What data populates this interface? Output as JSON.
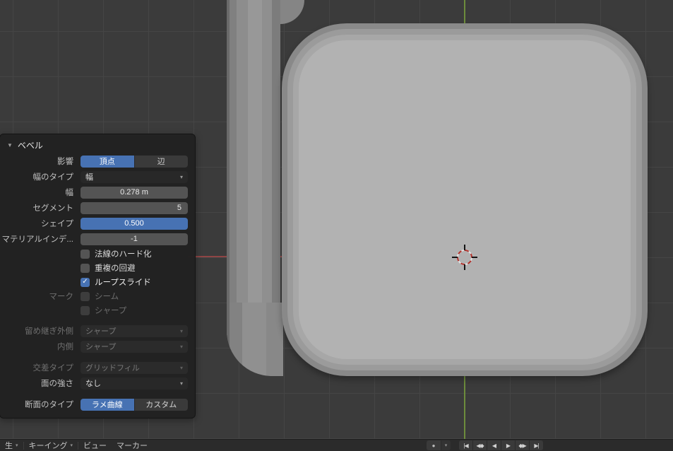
{
  "icons": {
    "panel_caret": "▼",
    "dropdown_chevron": "▾",
    "menu_chevron": "▾",
    "checkmark": "✓",
    "record": "●"
  },
  "colors": {
    "accent": "#4772b3",
    "axis_x": "#8f4545",
    "axis_y": "#6d8c3c"
  },
  "panel": {
    "title": "ベベル",
    "affect": {
      "label": "影響",
      "options": [
        {
          "label": "頂点",
          "selected": true
        },
        {
          "label": "辺",
          "selected": false
        }
      ]
    },
    "width_type": {
      "label": "幅のタイプ",
      "value": "幅"
    },
    "width": {
      "label": "幅",
      "value": "0.278 m"
    },
    "segments": {
      "label": "セグメント",
      "value": "5"
    },
    "shape": {
      "label": "シェイプ",
      "value": "0.500"
    },
    "material_index": {
      "label": "マテリアルインデ...",
      "value": "-1"
    },
    "harden_normals": {
      "label": "法線のハード化",
      "checked": false
    },
    "clamp_overlap": {
      "label": "重複の回避",
      "checked": false
    },
    "loop_slide": {
      "label": "ループスライド",
      "checked": true
    },
    "mark_label": "マーク",
    "seam": {
      "label": "シーム",
      "checked": false
    },
    "sharp": {
      "label": "シャープ",
      "checked": false
    },
    "miter_outer": {
      "label": "留め継ぎ外側",
      "value": "シャープ"
    },
    "miter_inner": {
      "label": "内側",
      "value": "シャープ"
    },
    "intersection_type": {
      "label": "交差タイプ",
      "value": "グリッドフィル"
    },
    "face_strength": {
      "label": "面の強さ",
      "value": "なし"
    },
    "profile_type": {
      "label": "断面のタイプ",
      "options": [
        {
          "label": "ラメ曲線",
          "selected": true
        },
        {
          "label": "カスタム",
          "selected": false
        }
      ]
    }
  },
  "timeline": {
    "menus": [
      {
        "label": "生"
      },
      {
        "label": "キーイング"
      },
      {
        "label": "ビュー"
      },
      {
        "label": "マーカー"
      }
    ],
    "transport": [
      "|◀",
      "◀◆",
      "◀",
      "▶",
      "◆▶",
      "▶|"
    ]
  }
}
